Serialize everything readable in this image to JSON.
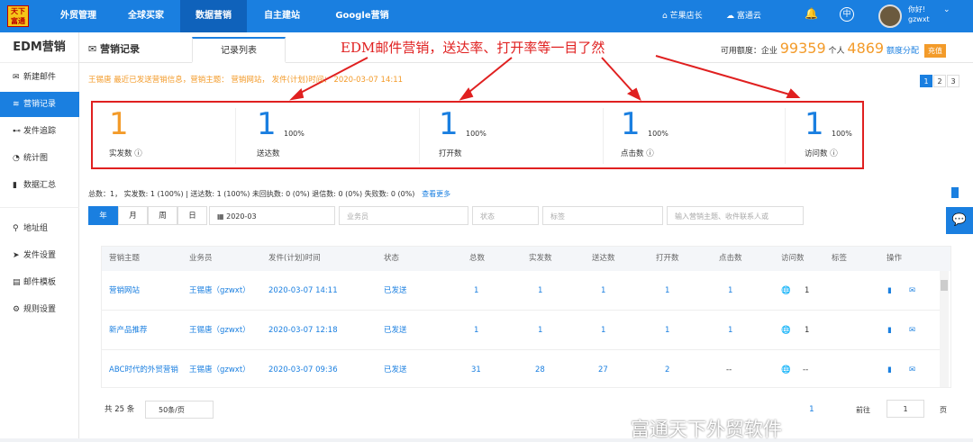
{
  "topbar": {
    "logo_text": "天下富通",
    "nav": [
      "外贸管理",
      "全球买家",
      "数据营销",
      "自主建站",
      "Google营销"
    ],
    "right_links": [
      "芒果店长",
      "富通云"
    ],
    "user": {
      "greeting": "你好!",
      "name": "gzwxt"
    }
  },
  "sidebar": {
    "title": "EDM营销",
    "items": [
      {
        "label": "新建邮件",
        "icon": "envelope-icon"
      },
      {
        "label": "营销记录",
        "icon": "layers-icon"
      },
      {
        "label": "发件追踪",
        "icon": "binoculars-icon"
      },
      {
        "label": "统计图",
        "icon": "pie-chart-icon"
      },
      {
        "label": "数据汇总",
        "icon": "bar-chart-icon"
      },
      {
        "label": "地址组",
        "icon": "location-icon"
      },
      {
        "label": "发件设置",
        "icon": "send-icon"
      },
      {
        "label": "邮件模板",
        "icon": "template-icon"
      },
      {
        "label": "规则设置",
        "icon": "gear-icon"
      }
    ]
  },
  "header": {
    "title": "营销记录",
    "tab": "记录列表",
    "banner": "EDM邮件营销，送达率、打开率等一目了然",
    "quota_label": "可用额度：企业",
    "enterprise_quota": "99359",
    "personal_label": "个人",
    "personal_quota": "4869",
    "allocate": "额度分配",
    "recharge": "充值"
  },
  "info_line": "王锡唐 最近已发送营销信息，营销主题： 营销网站， 发件(计划)时间： 2020-03-07 14:11",
  "pages_top": [
    "1",
    "2",
    "3"
  ],
  "stats": [
    {
      "value": "1",
      "pct": "",
      "label": "实发数"
    },
    {
      "value": "1",
      "pct": "100%",
      "label": "送达数"
    },
    {
      "value": "1",
      "pct": "100%",
      "label": "打开数"
    },
    {
      "value": "1",
      "pct": "100%",
      "label": "点击数"
    },
    {
      "value": "1",
      "pct": "100%",
      "label": "访问数"
    }
  ],
  "summary": "总数：1， 实发数: 1 (100%) | 送达数: 1 (100%) 未回执数: 0 (0%) 退信数: 0 (0%) 失败数: 0 (0%)",
  "summary_more": "查看更多",
  "filters": {
    "periods": [
      "年",
      "月",
      "周",
      "日"
    ],
    "date": "2020-03",
    "salesperson": "业务员",
    "status": "状态",
    "tag": "标签",
    "search_placeholder": "输入营销主题、收件联系人或"
  },
  "table": {
    "columns": [
      "营销主题",
      "业务员",
      "发件(计划)时间",
      "状态",
      "总数",
      "实发数",
      "送达数",
      "打开数",
      "点击数",
      "访问数",
      "标签",
      "操作"
    ],
    "rows": [
      {
        "subject": "营销网站",
        "sales": "王锡唐（gzwxt）",
        "time": "2020-03-07 14:11",
        "status": "已发送",
        "total": "1",
        "sent": "1",
        "delivered": "1",
        "opened": "1",
        "clicked": "1",
        "visits": "1"
      },
      {
        "subject": "新产品推荐",
        "sales": "王锡唐（gzwxt）",
        "time": "2020-03-07 12:18",
        "status": "已发送",
        "total": "1",
        "sent": "1",
        "delivered": "1",
        "opened": "1",
        "clicked": "1",
        "visits": "1"
      },
      {
        "subject": "ABC时代的外贸营销",
        "sales": "王锡唐（gzwxt）",
        "time": "2020-03-07 09:36",
        "status": "已发送",
        "total": "31",
        "sent": "28",
        "delivered": "27",
        "opened": "2",
        "clicked": "--",
        "visits": "--"
      }
    ]
  },
  "footer": {
    "total": "共 25 条",
    "page_size": "50条/页",
    "current": "1",
    "goto": "前往",
    "goto_value": "1",
    "page_unit": "页"
  },
  "watermark": "富通天下外贸软件",
  "colors": {
    "primary": "#1a7fe0",
    "accent": "#f39b2a",
    "annotation": "#e02020"
  }
}
